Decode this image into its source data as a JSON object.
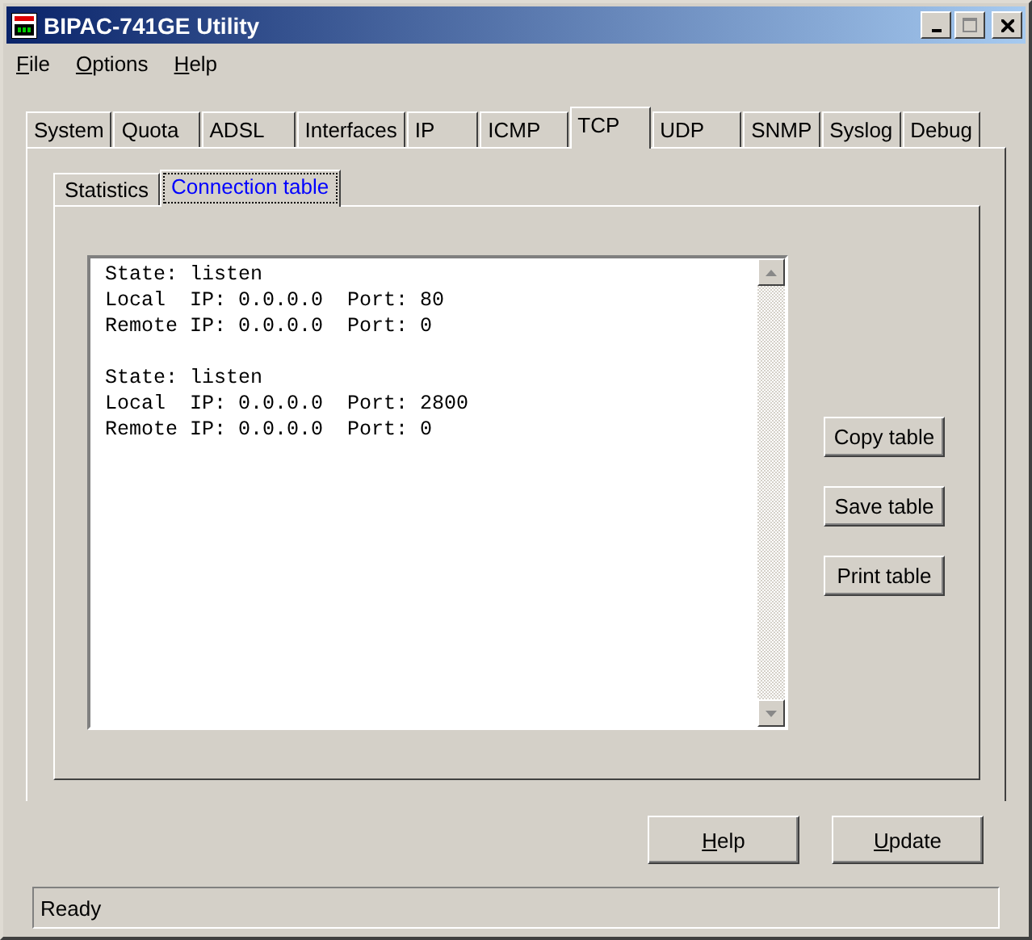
{
  "window": {
    "title": "BIPAC-741GE Utility"
  },
  "menu": [
    {
      "label": "File",
      "mnemonic": true
    },
    {
      "label": "Options",
      "mnemonic": true
    },
    {
      "label": "Help",
      "mnemonic": true
    }
  ],
  "tabs": [
    {
      "label": "System",
      "selected": false
    },
    {
      "label": "Quota",
      "selected": false
    },
    {
      "label": "ADSL",
      "selected": false
    },
    {
      "label": "Interfaces",
      "selected": false
    },
    {
      "label": "IP",
      "selected": false
    },
    {
      "label": "ICMP",
      "selected": false
    },
    {
      "label": "TCP",
      "selected": true
    },
    {
      "label": "UDP",
      "selected": false
    },
    {
      "label": "SNMP",
      "selected": false
    },
    {
      "label": "Syslog",
      "selected": false
    },
    {
      "label": "Debug",
      "selected": false
    }
  ],
  "subtabs": [
    {
      "label": "Statistics",
      "selected": false
    },
    {
      "label": "Connection table",
      "selected": true
    }
  ],
  "connections": [
    {
      "lines": [
        "State: listen",
        "Local  IP: 0.0.0.0  Port: 80",
        "Remote IP: 0.0.0.0  Port: 0"
      ]
    },
    {
      "lines": [
        "State: listen",
        "Local  IP: 0.0.0.0  Port: 2800",
        "Remote IP: 0.0.0.0  Port: 0"
      ]
    }
  ],
  "side_buttons": [
    "Copy table",
    "Save table",
    "Print table"
  ],
  "buttons": [
    {
      "label": "Help",
      "mnemonic": true
    },
    {
      "label": "Update",
      "mnemonic": true
    }
  ],
  "status_bar": "Ready"
}
